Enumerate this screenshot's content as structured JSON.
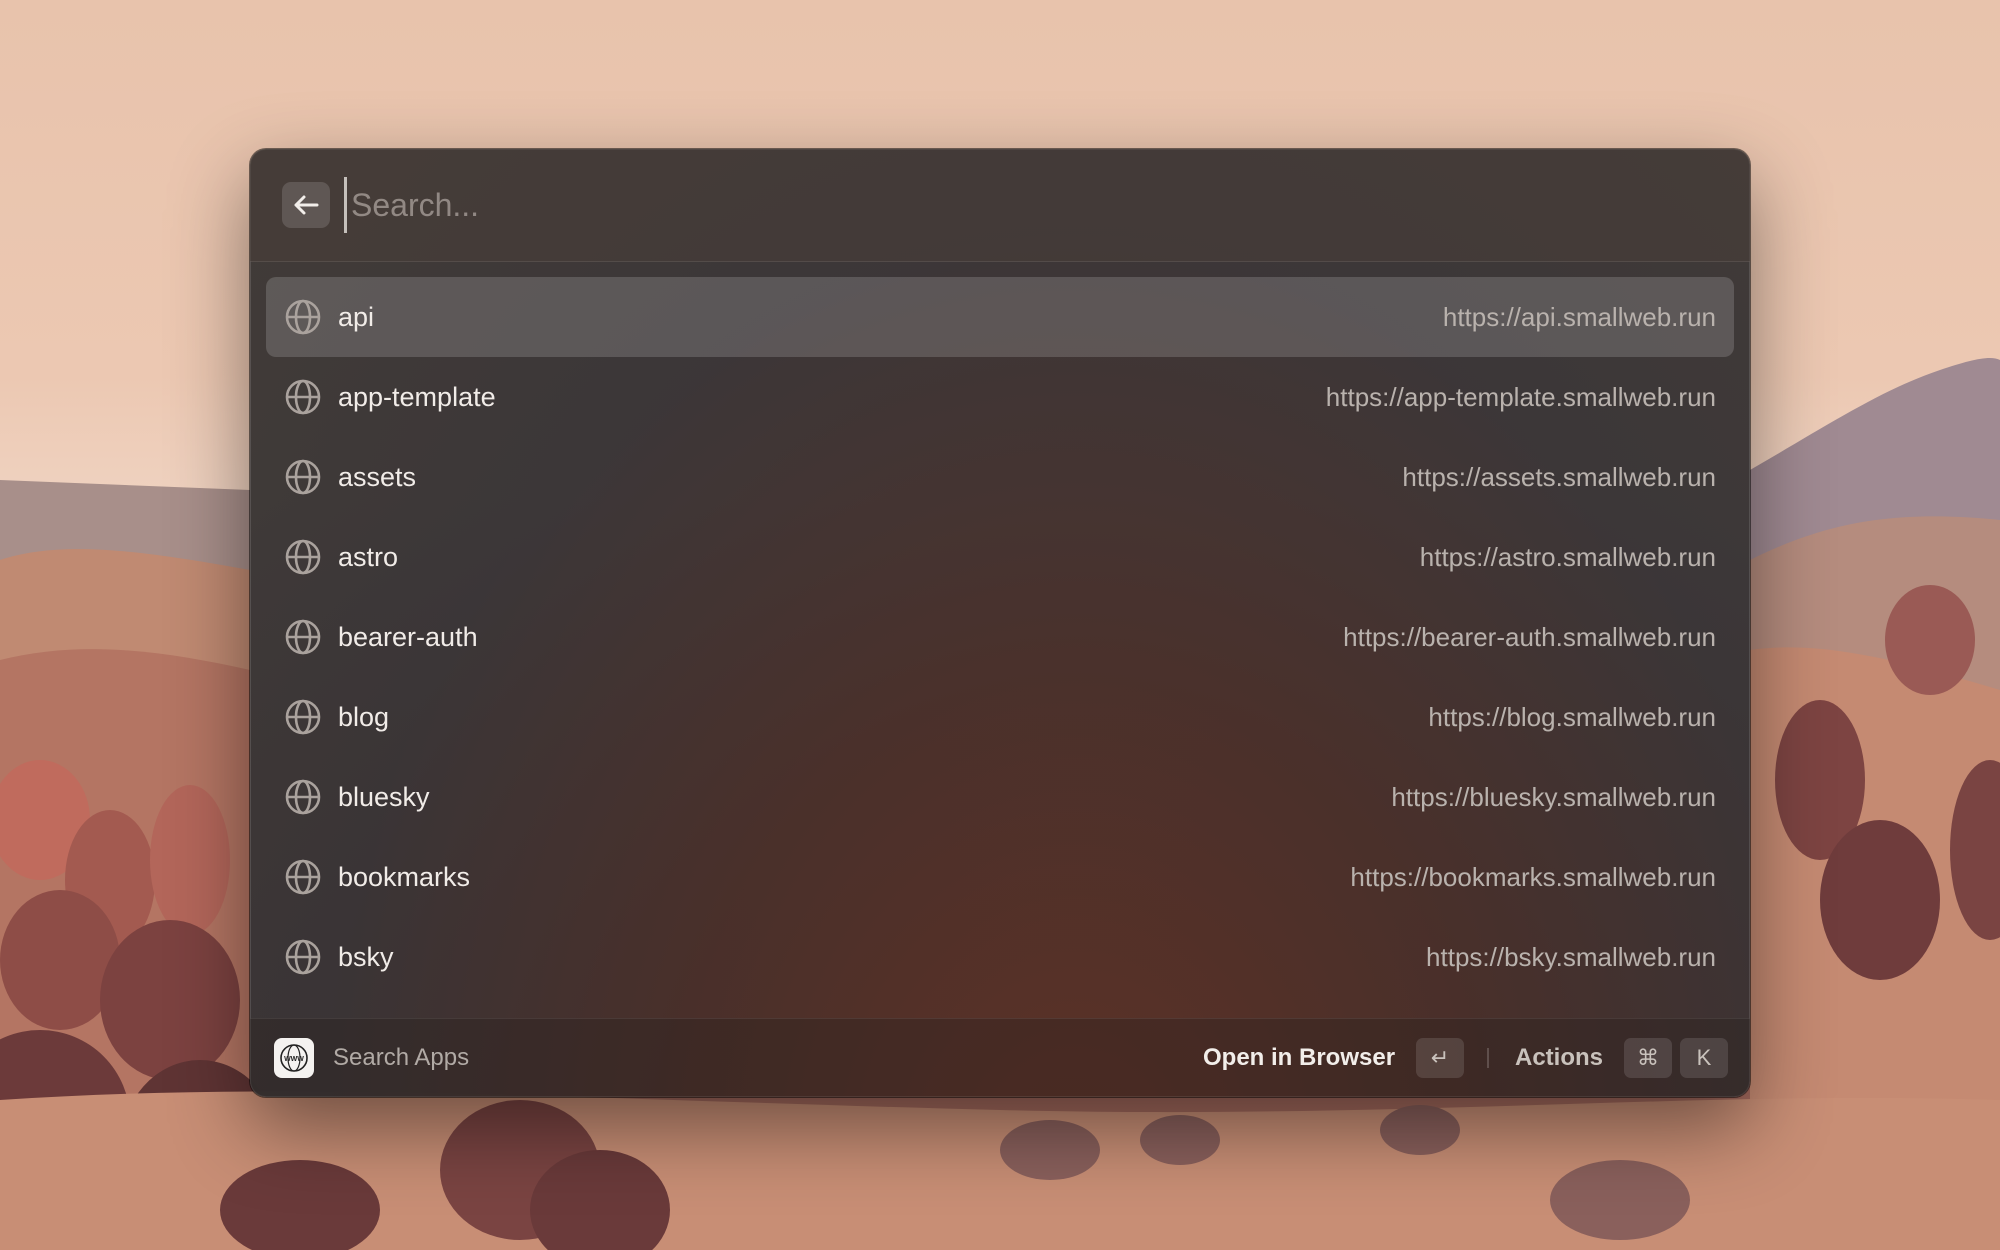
{
  "search": {
    "placeholder": "Search...",
    "value": "",
    "back_icon": "arrow-left-icon"
  },
  "results": [
    {
      "name": "api",
      "url": "https://api.smallweb.run",
      "icon": "globe-icon",
      "selected": true
    },
    {
      "name": "app-template",
      "url": "https://app-template.smallweb.run",
      "icon": "globe-icon",
      "selected": false
    },
    {
      "name": "assets",
      "url": "https://assets.smallweb.run",
      "icon": "globe-icon",
      "selected": false
    },
    {
      "name": "astro",
      "url": "https://astro.smallweb.run",
      "icon": "globe-icon",
      "selected": false
    },
    {
      "name": "bearer-auth",
      "url": "https://bearer-auth.smallweb.run",
      "icon": "globe-icon",
      "selected": false
    },
    {
      "name": "blog",
      "url": "https://blog.smallweb.run",
      "icon": "globe-icon",
      "selected": false
    },
    {
      "name": "bluesky",
      "url": "https://bluesky.smallweb.run",
      "icon": "globe-icon",
      "selected": false
    },
    {
      "name": "bookmarks",
      "url": "https://bookmarks.smallweb.run",
      "icon": "globe-icon",
      "selected": false
    },
    {
      "name": "bsky",
      "url": "https://bsky.smallweb.run",
      "icon": "globe-icon",
      "selected": false
    }
  ],
  "footer": {
    "title": "Search Apps",
    "logo_text": "WWW",
    "primary_action": "Open in Browser",
    "enter_key": "↵",
    "actions_label": "Actions",
    "cmd_key": "⌘",
    "k_key": "K"
  },
  "colors": {
    "panel": "#3a3535",
    "selected_row": "#5a5450",
    "text": "#f1ece8",
    "muted_text": "#b9b2ad"
  }
}
